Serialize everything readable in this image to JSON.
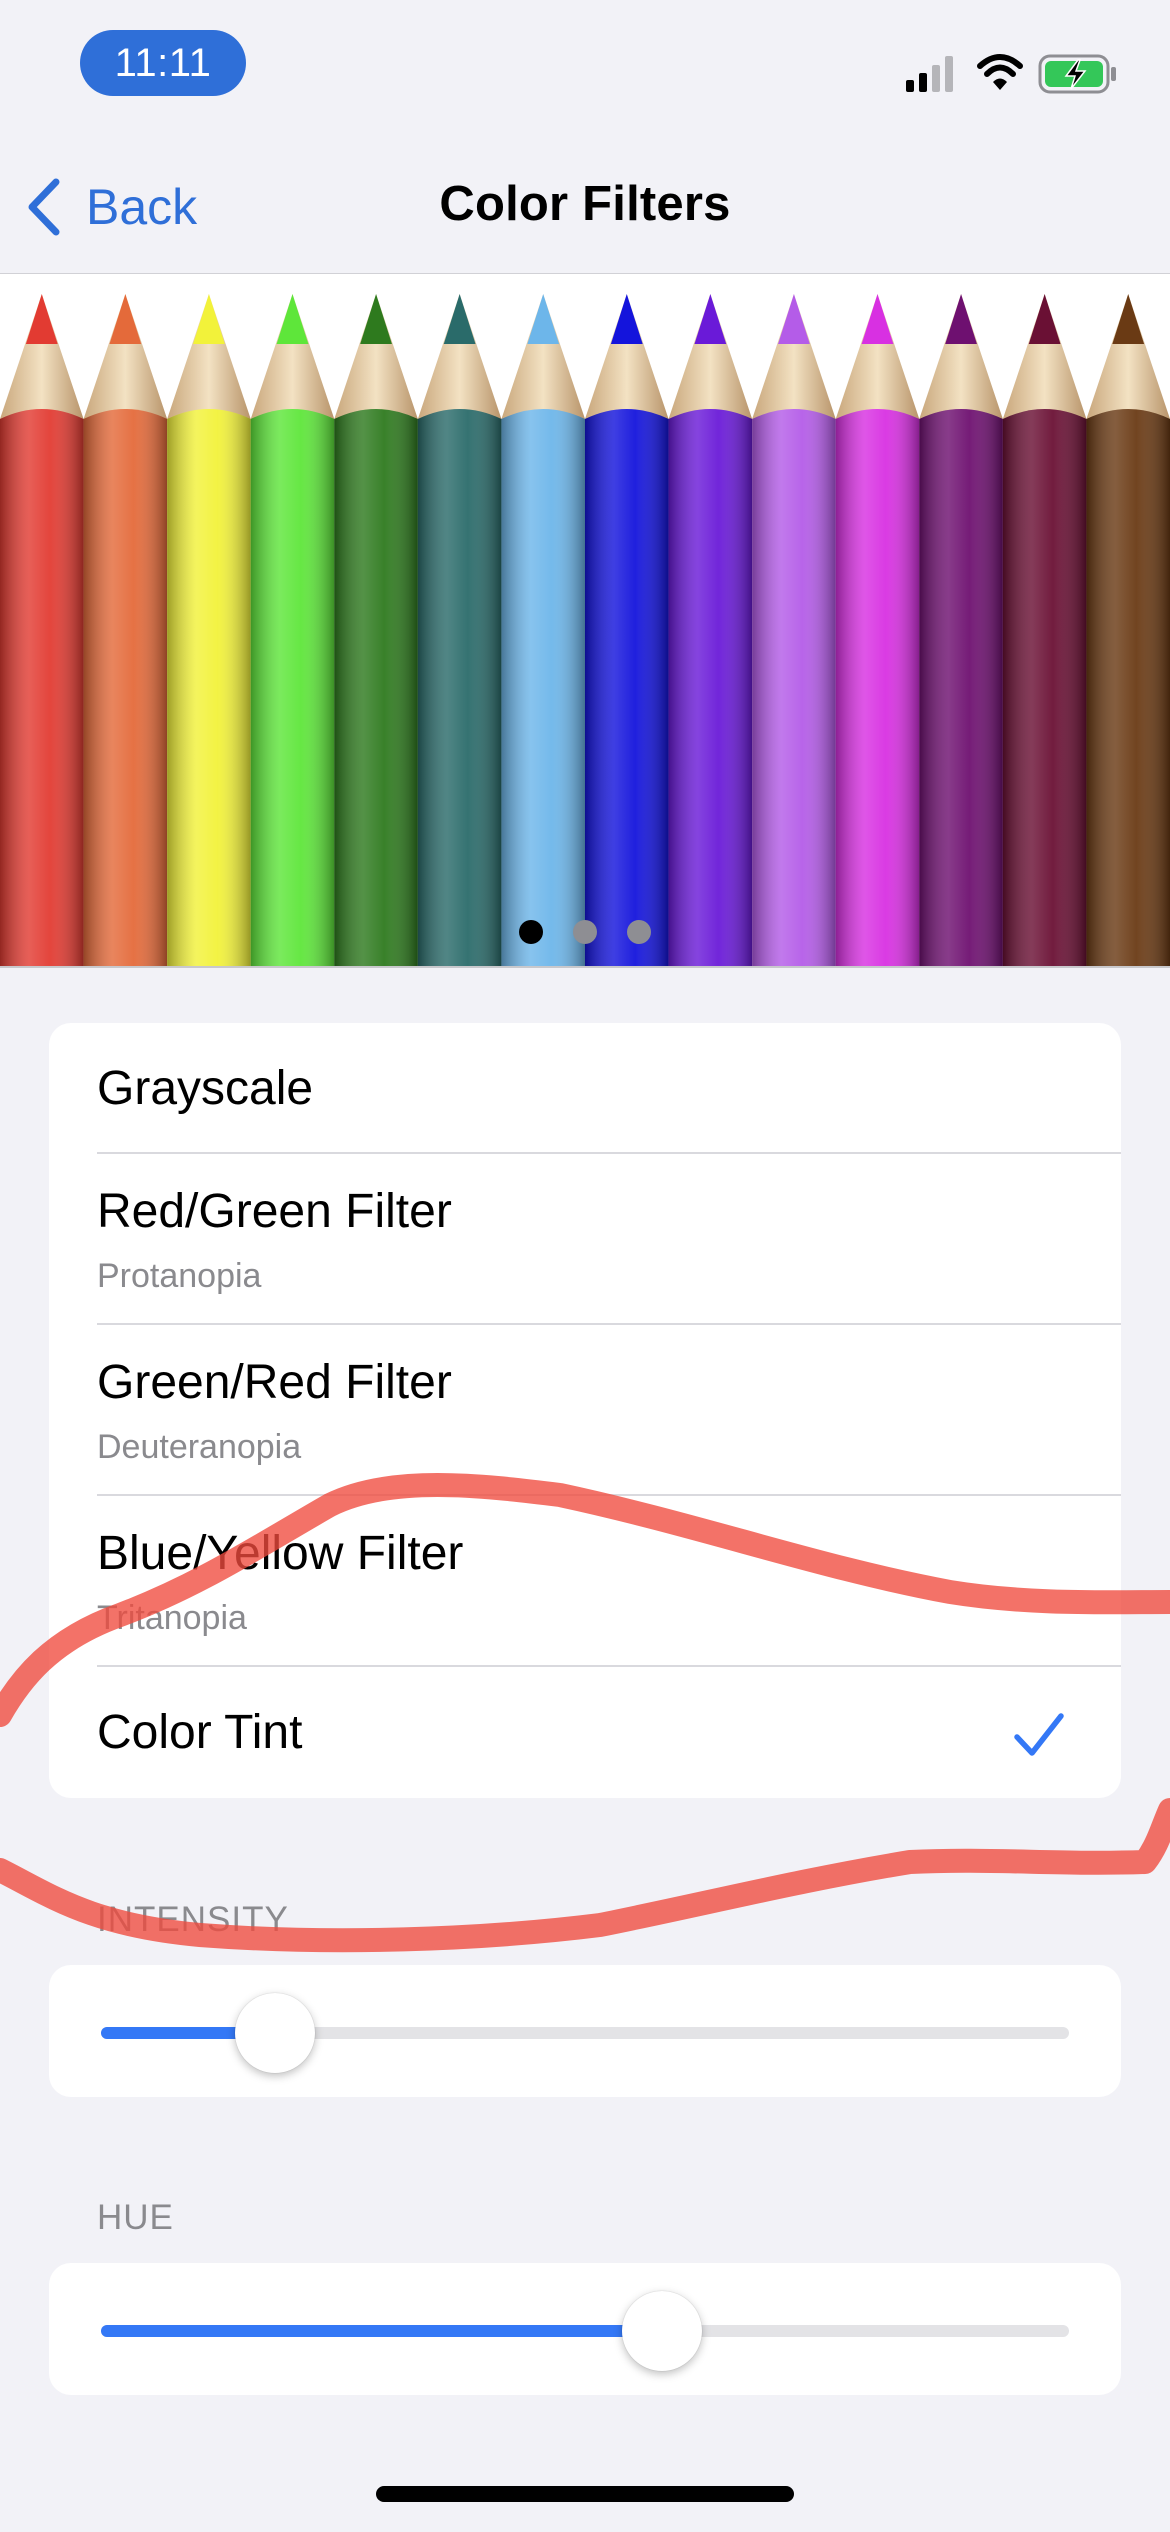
{
  "status_bar": {
    "time": "11:11",
    "signal_bars": 2,
    "battery_charging": true,
    "accent_color": "#2f6fd8",
    "battery_color": "#34c759"
  },
  "nav": {
    "back_label": "Back",
    "title": "Color Filters"
  },
  "preview": {
    "pencil_colors": [
      "#e23b32",
      "#e46a3a",
      "#f2f23a",
      "#5ee63a",
      "#2e7a1e",
      "#2a6b6a",
      "#6db6ea",
      "#1414dc",
      "#6a1ad8",
      "#b45ce8",
      "#d830e2",
      "#6e1070",
      "#6a1034",
      "#6a3a14"
    ],
    "pages": 3,
    "active_page": 1
  },
  "filters": [
    {
      "title": "Grayscale",
      "subtitle": "",
      "selected": false
    },
    {
      "title": "Red/Green Filter",
      "subtitle": "Protanopia",
      "selected": false
    },
    {
      "title": "Green/Red Filter",
      "subtitle": "Deuteranopia",
      "selected": false
    },
    {
      "title": "Blue/Yellow Filter",
      "subtitle": "Tritanopia",
      "selected": false
    },
    {
      "title": "Color Tint",
      "subtitle": "",
      "selected": true
    }
  ],
  "intensity": {
    "label": "INTENSITY",
    "value": 0.18
  },
  "hue": {
    "label": "HUE",
    "value": 0.58
  },
  "annotation": {
    "stroke_color": "#ef4a3e"
  }
}
